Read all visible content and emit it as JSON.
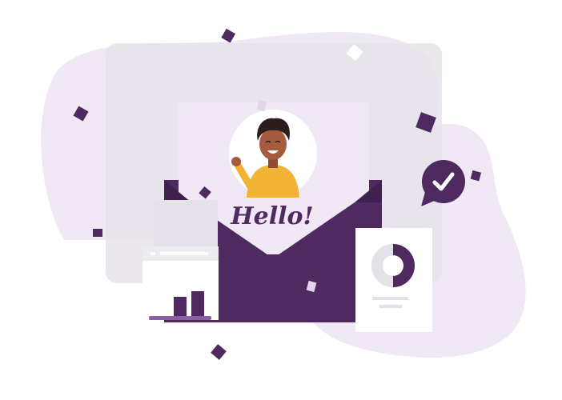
{
  "greeting": {
    "text": "Hello!"
  },
  "icons": {
    "checkmark": "check-badge-icon",
    "avatar": "waving-person-avatar",
    "envelope": "open-envelope-icon",
    "bar_chart": "bar-chart-card-icon",
    "donut_chart": "donut-chart-card-icon"
  },
  "colors": {
    "primary": "#4e2a60",
    "accent": "#8a5fa6",
    "blob": "#f1e8f6",
    "letter": "#f1e8f6",
    "confetti_dark": "#4e2a60",
    "confetti_light": "#e4d3ee",
    "skin": "#a65a3e",
    "hair": "#2a1d1a",
    "shirt": "#f2b336"
  }
}
